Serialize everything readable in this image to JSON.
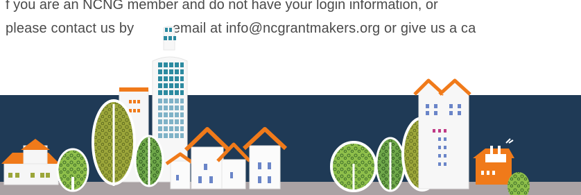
{
  "intro": {
    "line1": "f you are an NCNG member and do not have your login information, or",
    "line2_prefix": "please contact us by",
    "line2_gap": "",
    "line2_after_gap": "email at ",
    "email": "info@ncgrantmakers.org",
    "line2_suffix": " or give us a ca"
  },
  "colors": {
    "text": "#4a4a4a",
    "dark_band": "#1f3a56",
    "ground": "#aaa2a4",
    "roof_orange": "#f07a1a",
    "tree_green": "#8ebf4a",
    "tree_olive": "#9ca63a",
    "window_blue": "#6a85c8",
    "window_teal": "#2b8aa0"
  },
  "icons": {
    "skyscraper": "skyscraper-illustration",
    "house": "house-illustration",
    "tree": "tree-illustration",
    "tower": "tower-illustration"
  }
}
